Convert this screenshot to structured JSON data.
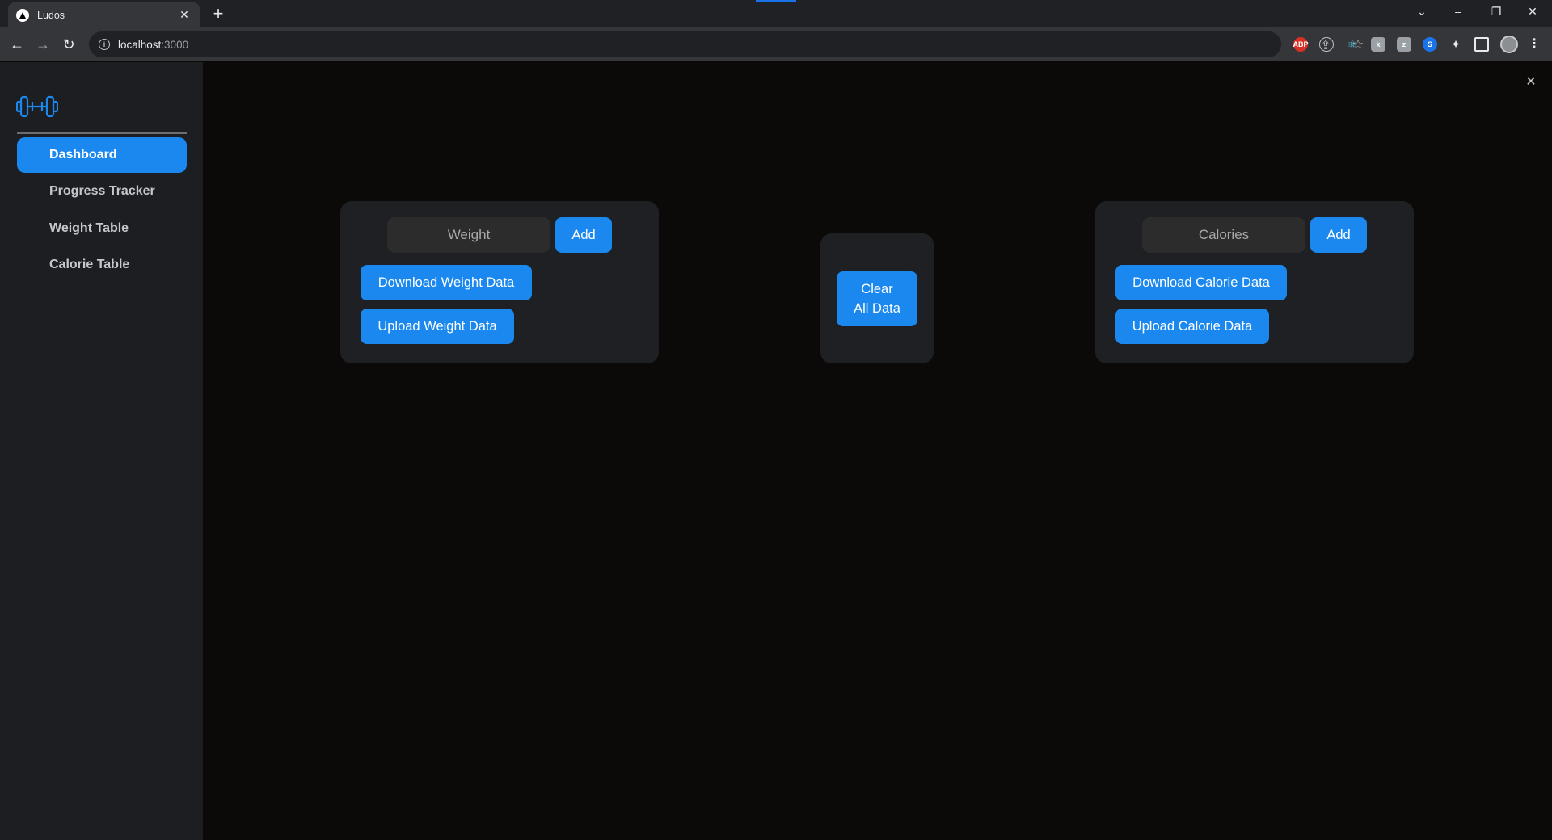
{
  "browser": {
    "tab_title": "Ludos",
    "tab_close": "✕",
    "new_tab": "+",
    "url_host": "localhost",
    "url_port": ":3000",
    "extensions": [
      "ABP",
      "bulb",
      "react",
      "k",
      "z",
      "shazam",
      "puzzle"
    ]
  },
  "sidebar": {
    "items": [
      {
        "label": "Dashboard",
        "active": true
      },
      {
        "label": "Progress Tracker",
        "active": false
      },
      {
        "label": "Weight Table",
        "active": false
      },
      {
        "label": "Calorie Table",
        "active": false
      }
    ]
  },
  "weight_card": {
    "input_placeholder": "Weight",
    "add_label": "Add",
    "download_label": "Download Weight Data",
    "upload_label": "Upload Weight Data"
  },
  "clear_card": {
    "line1": "Clear",
    "line2": "All Data"
  },
  "calorie_card": {
    "input_placeholder": "Calories",
    "add_label": "Add",
    "download_label": "Download Calorie Data",
    "upload_label": "Upload Calorie Data"
  },
  "colors": {
    "accent": "#1a88ee",
    "sidebar_bg": "#1d1e22",
    "page_bg": "#0b0a09",
    "card_bg": "#1f2024"
  }
}
